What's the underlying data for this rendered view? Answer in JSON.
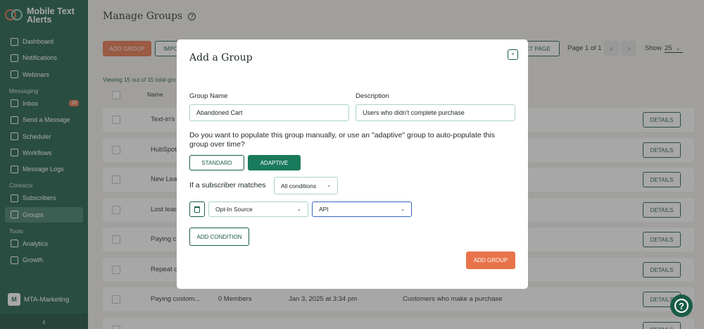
{
  "brand": {
    "name": "Mobile Text Alerts"
  },
  "sidebar": {
    "items": [
      {
        "label": "Dashboard",
        "icon": "home-icon"
      },
      {
        "label": "Notifications",
        "icon": "bell-icon"
      },
      {
        "label": "Webinars",
        "icon": "video-icon"
      }
    ],
    "section_messaging": "Messaging",
    "messaging": [
      {
        "label": "Inbox",
        "icon": "inbox-icon",
        "badge": "18"
      },
      {
        "label": "Send a Message",
        "icon": "send-icon"
      },
      {
        "label": "Scheduler",
        "icon": "clock-icon"
      },
      {
        "label": "Workflows",
        "icon": "workflow-icon"
      },
      {
        "label": "Message Logs",
        "icon": "log-icon"
      }
    ],
    "section_contacts": "Contacts",
    "contacts": [
      {
        "label": "Subscribers",
        "icon": "users-icon"
      },
      {
        "label": "Groups",
        "icon": "groups-icon",
        "active": true
      }
    ],
    "section_tools": "Tools",
    "tools": [
      {
        "label": "Analytics",
        "icon": "chart-icon"
      },
      {
        "label": "Growth",
        "icon": "grid-icon"
      }
    ],
    "account": {
      "initial": "M",
      "name": "MTA-Marketing"
    },
    "collapse": "‹"
  },
  "page": {
    "title": "Manage Groups",
    "add_group": "ADD GROUP",
    "import_partial": "IMPO",
    "select_page_partial": "CT PAGE",
    "page_info": "Page 1 of 1",
    "show_label": "Show",
    "show_value": "25",
    "table_info": "Viewing 15 out of 15 total gro",
    "col_name": "Name",
    "details": "DETAILS",
    "rows": [
      {
        "name": "Text-in's (",
        "members": "",
        "date": "",
        "desc": ""
      },
      {
        "name": "HubSpot",
        "members": "",
        "date": "",
        "desc": ""
      },
      {
        "name": "New Lead",
        "members": "",
        "date": "",
        "desc": ""
      },
      {
        "name": "Lost lead",
        "members": "",
        "date": "",
        "desc": ""
      },
      {
        "name": "Paying cu",
        "members": "",
        "date": "",
        "desc": ""
      },
      {
        "name": "Repeat cu",
        "members": "",
        "date": "",
        "desc": ""
      },
      {
        "name": "Paying custom...",
        "members": "0 Members",
        "date": "Jan 3, 2025 at 3:34 pm",
        "desc": "Customers who make a purchase"
      }
    ]
  },
  "modal": {
    "title": "Add a Group",
    "close": "×",
    "group_name_label": "Group Name",
    "group_name_value": "Abandoned Cart",
    "description_label": "Description",
    "description_value": "Users who didn't complete purchase",
    "question": "Do you want to populate this group manually, or use an \"adaptive\" group to auto-populate this group over time?",
    "standard": "STANDARD",
    "adaptive": "ADAPTIVE",
    "matches_label": "If a subscriber matches",
    "matches_value": "All conditions",
    "condition_field": "Opt-In Source",
    "condition_value": "API",
    "add_condition": "ADD CONDITION",
    "add_group": "ADD GROUP"
  },
  "colors": {
    "primary": "#1a5c46",
    "accent": "#e8734a",
    "focus": "#3a66c4"
  }
}
